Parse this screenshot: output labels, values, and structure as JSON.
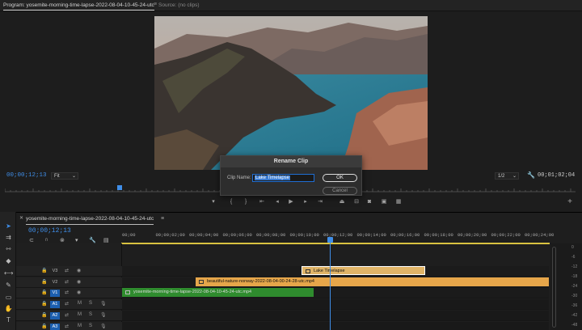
{
  "monitor": {
    "program_tab": "Program: yosemite-morning-time-lapse-2022-08-04-10-45-24-utc",
    "source_tab": "Source: (no clips)",
    "timecode_current": "00;00;12;13",
    "fit_label": "Fit",
    "resolution": "1/2",
    "timecode_total": "00;01;02;04",
    "playhead_fraction": 0.2
  },
  "dialog": {
    "title": "Rename Clip",
    "clip_name_label": "Clip Name:",
    "clip_name_value": "Lake Timelapse",
    "ok_label": "OK",
    "cancel_label": "Cancel"
  },
  "timeline": {
    "sequence_tab": "yosemite-morning-time-lapse-2022-08-04-10-45-24-utc",
    "timecode": "00;00;12;13",
    "ruler_ticks": [
      "00;00",
      "00;00;02;00",
      "00;00;04;00",
      "00;00;06;00",
      "00;00;08;00",
      "00;00;10;00",
      "00;00;12;00",
      "00;00;14;00",
      "00;00;16;00",
      "00;00;18;00",
      "00;00;20;00",
      "00;00;22;00",
      "00;00;24;00"
    ],
    "tracks": [
      {
        "label": "V3",
        "selected": false
      },
      {
        "label": "V2",
        "selected": false
      },
      {
        "label": "V1",
        "selected": true
      },
      {
        "label": "A1",
        "selected": true
      },
      {
        "label": "A2",
        "selected": true
      },
      {
        "label": "A3",
        "selected": true
      }
    ],
    "track_toggles": {
      "mute": "M",
      "solo": "S"
    },
    "clips": {
      "lake": "Lake Timelapse",
      "norway": "beautiful-nature-norway-2022-08-04-00-24-28-utc.mp4",
      "yosemite": "yosemite-morning-time-lapse-2022-08-04-10-45-24-utc.mp4"
    },
    "meter_labels": [
      "0",
      "-6",
      "-12",
      "-18",
      "-24",
      "-30",
      "-36",
      "-42",
      "-48"
    ]
  },
  "colors": {
    "accent_blue": "#3f8ee8",
    "clip_orange": "#e6a64a",
    "clip_green": "#2f8c2e",
    "work_area_yellow": "#d9c240"
  }
}
